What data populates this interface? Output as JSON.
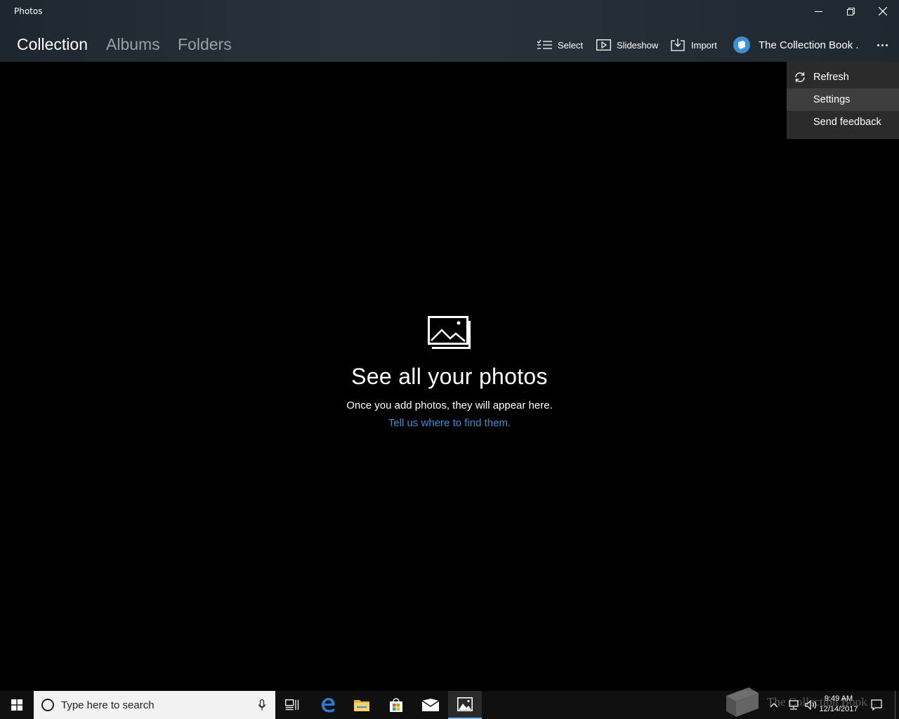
{
  "window": {
    "title": "Photos"
  },
  "nav": {
    "tabs": [
      {
        "label": "Collection",
        "active": true
      },
      {
        "label": "Albums",
        "active": false
      },
      {
        "label": "Folders",
        "active": false
      }
    ]
  },
  "commands": {
    "select": "Select",
    "slideshow": "Slideshow",
    "import": "Import",
    "account": "The Collection Book ."
  },
  "menu": {
    "items": [
      {
        "label": "Refresh",
        "icon": "refresh-icon"
      },
      {
        "label": "Settings",
        "hovered": true
      },
      {
        "label": "Send feedback"
      }
    ]
  },
  "empty_state": {
    "title": "See all your photos",
    "subtitle": "Once you add photos, they will appear here.",
    "link": "Tell us where to find them."
  },
  "taskbar": {
    "search_placeholder": "Type here to search",
    "time": "9:49 AM",
    "date": "12/14/2017",
    "watermark": "The Collection Book"
  },
  "colors": {
    "accent": "#3d8fd6",
    "menu_bg": "#2b2b2b",
    "menu_hover": "#3e3e3e",
    "taskbar_bg": "#101010"
  }
}
